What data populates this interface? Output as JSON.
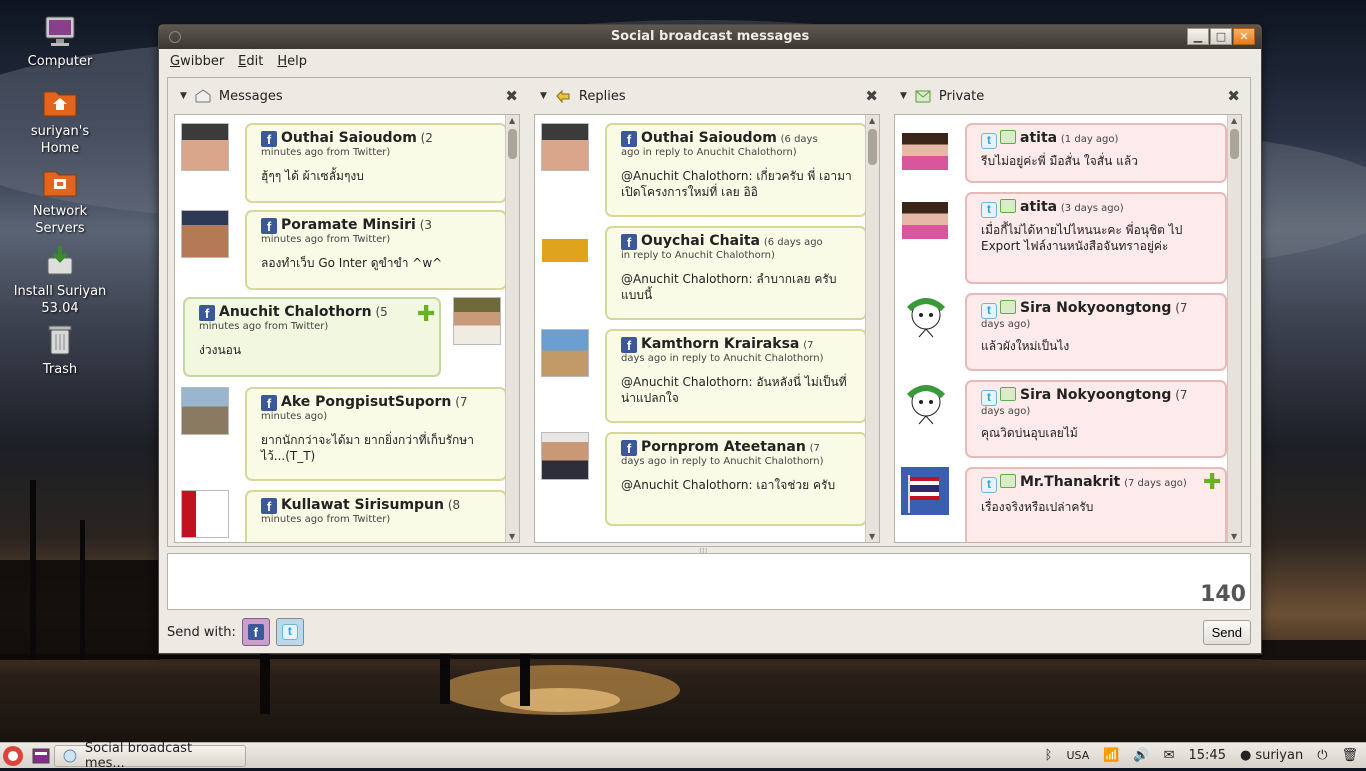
{
  "desktop": {
    "icons": [
      {
        "label": "Computer",
        "icon": "computer-icon"
      },
      {
        "label": "suriyan's Home",
        "icon": "home-folder-icon"
      },
      {
        "label": "Network Servers",
        "icon": "network-folder-icon"
      },
      {
        "label": "Install Suriyan 53.04",
        "icon": "install-icon"
      },
      {
        "label": "Trash",
        "icon": "trash-icon"
      }
    ]
  },
  "window": {
    "title": "Social broadcast messages",
    "buttons": {
      "minimize": "▁",
      "maximize": "□",
      "close": "✕"
    }
  },
  "menu": [
    "Gwibber",
    "Edit",
    "Help"
  ],
  "panes": [
    {
      "title": "Messages",
      "icon": "envelope-icon",
      "items": [
        {
          "name": "Outhai Saioudom",
          "time": "(2",
          "time2": "minutes ago",
          "source": "from Twitter)",
          "text": "ฮุ้ๆๆ ได้ ผ้าเซลั้มๆงบ",
          "style": "yellow",
          "net": "facebook"
        },
        {
          "name": "Poramate Minsiri",
          "time": "(3",
          "time2": "minutes ago",
          "source": "from Twitter)",
          "text": "ลองทำเว็บ Go Inter ดูขำขำ ^w^",
          "style": "yellow",
          "net": "facebook"
        },
        {
          "name": "Anuchit Chalothorn",
          "time": "(5",
          "time2": "minutes ago",
          "source": "from Twitter)",
          "text": "ง่วงนอน",
          "style": "green",
          "net": "facebook"
        },
        {
          "name": "Ake PongpisutSuporn",
          "time": "(7",
          "time2": "minutes ago)",
          "source": "",
          "text": "ยากนักกว่าจะได้มา ยากยิ่งกว่าที่เก็บรักษาไว้...(T_T)",
          "style": "yellow",
          "net": "facebook"
        },
        {
          "name": "Kullawat Sirisumpun",
          "time": "(8",
          "time2": "minutes ago",
          "source": "from Twitter)",
          "text": "",
          "style": "yellow",
          "net": "facebook"
        }
      ]
    },
    {
      "title": "Replies",
      "icon": "replies-icon",
      "items": [
        {
          "name": "Outhai Saioudom",
          "time": "(6 days",
          "time2": "ago",
          "source": "in reply to Anuchit Chalothorn)",
          "text": "@Anuchit Chalothorn: เกี่ยวครับ พี่ เอามาเปิดโครงการใหม่ที่ เลย อิอิ"
        },
        {
          "name": "Ouychai Chaita",
          "time": "(6 days ago",
          "time2": "",
          "source": "in reply to Anuchit Chalothorn)",
          "text": "@Anuchit Chalothorn: ลำบากเลย ครับแบบนี้"
        },
        {
          "name": "Kamthorn Krairaksa",
          "time": "(7",
          "time2": "days ago",
          "source": "in reply to Anuchit Chalothorn)",
          "text": "@Anuchit Chalothorn: อันหลังนี่ ไม่เป็นที่น่าแปลกใจ"
        },
        {
          "name": "Pornprom Ateetanan",
          "time": "(7",
          "time2": "days ago",
          "source": "in reply to Anuchit Chalothorn)",
          "text": "@Anuchit Chalothorn: เอาใจช่วย ครับ"
        }
      ]
    },
    {
      "title": "Private",
      "icon": "private-icon",
      "items": [
        {
          "name": "atita",
          "time": "(1 day ago)",
          "text": "รีบไม่อยู่ค่ะพี่ มือสั่น ใจสั่น แล้ว"
        },
        {
          "name": "atita",
          "time": "(3 days ago)",
          "text": "เมื่อกี้ไม่ได้หายไปไหนนะคะ พี่อนุชิต ไป Export ไฟล์งานหนังสือจันทราอยู่ค่ะ"
        },
        {
          "name": "Sira Nokyoongtong",
          "time": "(7",
          "time2": "days ago)",
          "text": "แล้วผังใหม่เป็นไง"
        },
        {
          "name": "Sira Nokyoongtong",
          "time": "(7",
          "time2": "days ago)",
          "text": "คุณวิดบ่นอุบเลยไม้"
        },
        {
          "name": "Mr.Thanakrit",
          "time": "(7 days ago)",
          "text": "เรื่องจริงหรือเปล่าครับ"
        }
      ]
    }
  ],
  "compose": {
    "counter": "140",
    "send_with_label": "Send with:",
    "send_label": "Send"
  },
  "taskbar": {
    "task_label": "Social broadcast mes...",
    "keyboard": "USA",
    "clock": "15:45",
    "user": "suriyan"
  },
  "colors": {
    "facebook": "#3b5998",
    "reply_bubble": "#fafbe6",
    "own_bubble": "#f1f8df",
    "private_bubble": "#fdeaea"
  }
}
